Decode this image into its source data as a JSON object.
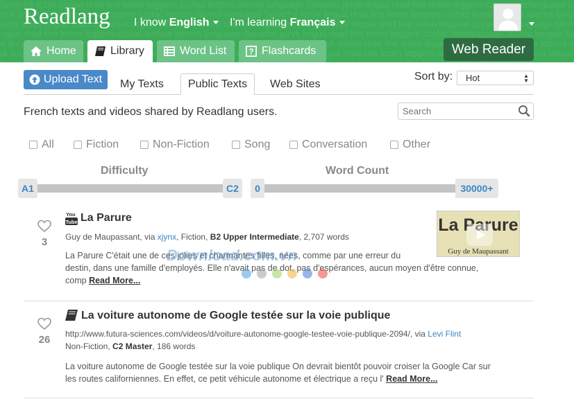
{
  "header": {
    "logo": "Readlang",
    "background_words": "Sprache język lingua read line lesen leggere czytać lecture idioma language Sprache język lingua read line lesen leggere czytać leerlanguage idioma langue Sprache język lingua read line lesen leggere czytać",
    "i_know_label": "I know",
    "i_know_value": "English",
    "learning_label": "I'm learning",
    "learning_value": "Français",
    "tabs": [
      {
        "label": "Home",
        "icon": "home-icon"
      },
      {
        "label": "Library",
        "icon": "book-icon"
      },
      {
        "label": "Word List",
        "icon": "list-icon"
      },
      {
        "label": "Flashcards",
        "icon": "question-icon"
      }
    ],
    "web_reader": "Web Reader"
  },
  "subnav": {
    "upload": "Upload Text",
    "tabs": [
      "My Texts",
      "Public Texts",
      "Web Sites"
    ],
    "sort_label": "Sort by:",
    "sort_value": "Hot"
  },
  "description": "French texts and videos shared by Readlang users.",
  "search": {
    "placeholder": "Search"
  },
  "filters": [
    "All",
    "Fiction",
    "Non-Fiction",
    "Song",
    "Conversation",
    "Other"
  ],
  "sliders": {
    "difficulty": {
      "title": "Difficulty",
      "min": "A1",
      "max": "C2"
    },
    "word_count": {
      "title": "Word Count",
      "min": "0",
      "max": "30000+"
    }
  },
  "items": [
    {
      "likes": "3",
      "icon": "youtube-icon",
      "title": "La Parure",
      "author": "Guy de Maupassant, via",
      "user": "xjynx",
      "category": ", Fiction,",
      "level": "B2 Upper Intermediate",
      "words": ", 2,707 words",
      "excerpt_1": "La Parure C'était une de ces jolies et charmantes filles, nées, comme par une erreur du",
      "excerpt_2": "destin, dans une famille d'employés. Elle n'avait pas de dot, pas d'espérances, aucun moyen d'être connue,",
      "excerpt_3": "comp",
      "read_more": "Read More...",
      "thumb_title": "La Parure",
      "thumb_author": "Guy de Maupassant"
    },
    {
      "likes": "26",
      "icon": "book-icon",
      "title": "La voiture autonome de Google testée sur la voie publique",
      "url": "http://www.futura-sciences.com/videos/d/voiture-autonome-google-testee-voie-publique-2094/, via",
      "user": "Levi Flint",
      "category": "Non-Fiction,",
      "level": "C2 Master",
      "words": ", 186 words",
      "excerpt_1": "La voiture autonome de Google testée sur la voie publique On devrait bientôt pouvoir croiser la Google Car sur",
      "excerpt_2": "les routes californiennes. En effet, ce petit véhicule autonome et électrique a reçu l'",
      "read_more": "Read More..."
    }
  ],
  "watermark": "Download.com.vn",
  "colors": {
    "header_green": "#3cac58",
    "tab_green": "#6cc385",
    "web_reader": "#2e6b41",
    "upload_blue": "#4a89c8",
    "link_blue": "#3b86c4"
  }
}
